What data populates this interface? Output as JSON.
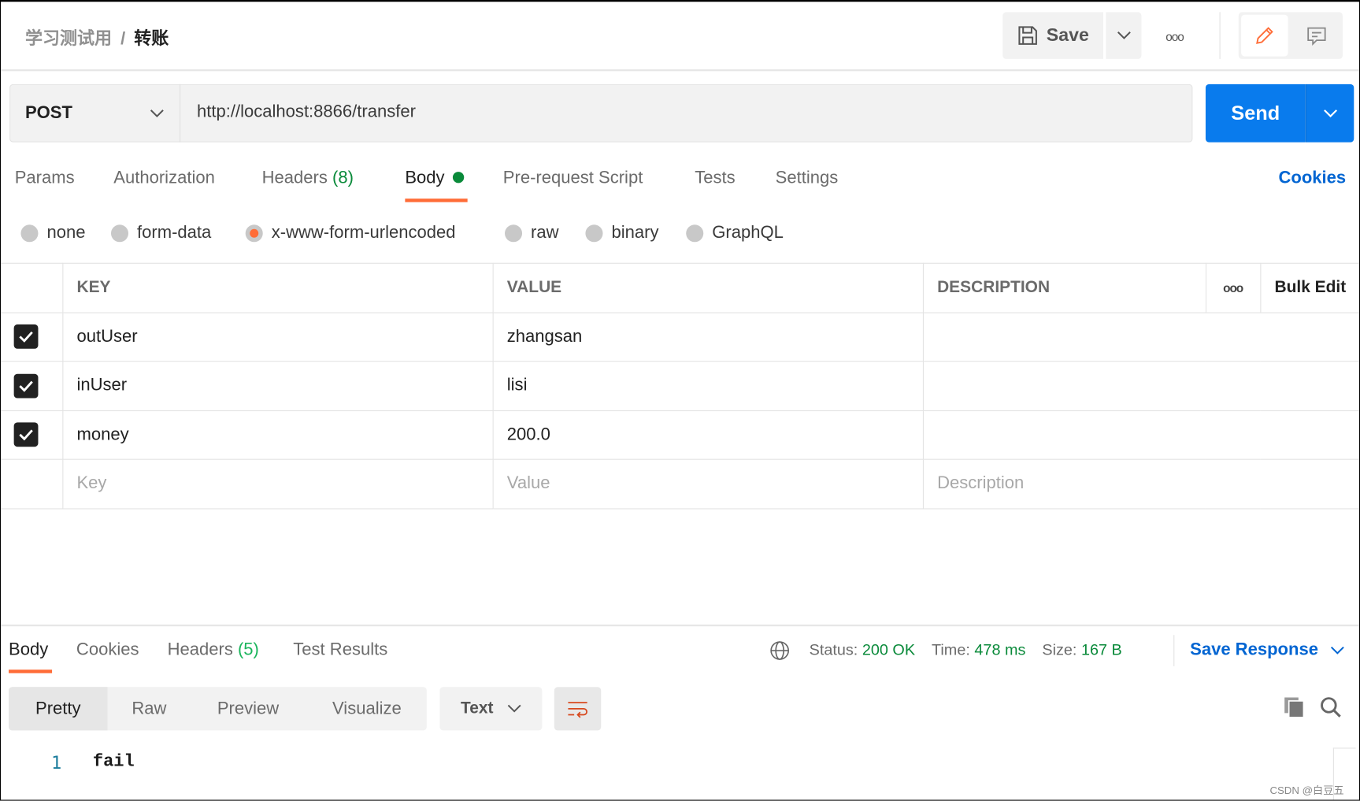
{
  "header": {
    "collection": "学习测试用",
    "separator": "/",
    "request_name": "转账",
    "save_label": "Save"
  },
  "request": {
    "method": "POST",
    "url": "http://localhost:8866/transfer",
    "send_label": "Send"
  },
  "tabs": {
    "params": "Params",
    "authorization": "Authorization",
    "headers": "Headers",
    "headers_count": "(8)",
    "body": "Body",
    "pre_request": "Pre-request Script",
    "tests": "Tests",
    "settings": "Settings",
    "cookies": "Cookies",
    "active": "Body"
  },
  "body_types": {
    "options": [
      "none",
      "form-data",
      "x-www-form-urlencoded",
      "raw",
      "binary",
      "GraphQL"
    ],
    "selected": "x-www-form-urlencoded"
  },
  "table": {
    "headers": {
      "key": "KEY",
      "value": "VALUE",
      "description": "DESCRIPTION",
      "bulk_edit": "Bulk Edit"
    },
    "rows": [
      {
        "checked": true,
        "key": "outUser",
        "value": "zhangsan"
      },
      {
        "checked": true,
        "key": "inUser",
        "value": "lisi"
      },
      {
        "checked": true,
        "key": "money",
        "value": "200.0"
      }
    ],
    "placeholders": {
      "key": "Key",
      "value": "Value",
      "description": "Description"
    }
  },
  "response": {
    "tabs": {
      "body": "Body",
      "cookies": "Cookies",
      "headers": "Headers",
      "headers_count": "(5)",
      "test_results": "Test Results"
    },
    "status_label": "Status:",
    "status": "200 OK",
    "time_label": "Time:",
    "time": "478 ms",
    "size_label": "Size:",
    "size": "167 B",
    "save_response": "Save Response",
    "views": [
      "Pretty",
      "Raw",
      "Preview",
      "Visualize"
    ],
    "active_view": "Pretty",
    "format": "Text",
    "lines": [
      {
        "number": "1",
        "text": "fail"
      }
    ]
  },
  "watermark": "CSDN @白豆五",
  "colors": {
    "accent": "#ff6c37",
    "send": "#097bed",
    "link": "#0265d2",
    "success": "#0a8a3a"
  }
}
